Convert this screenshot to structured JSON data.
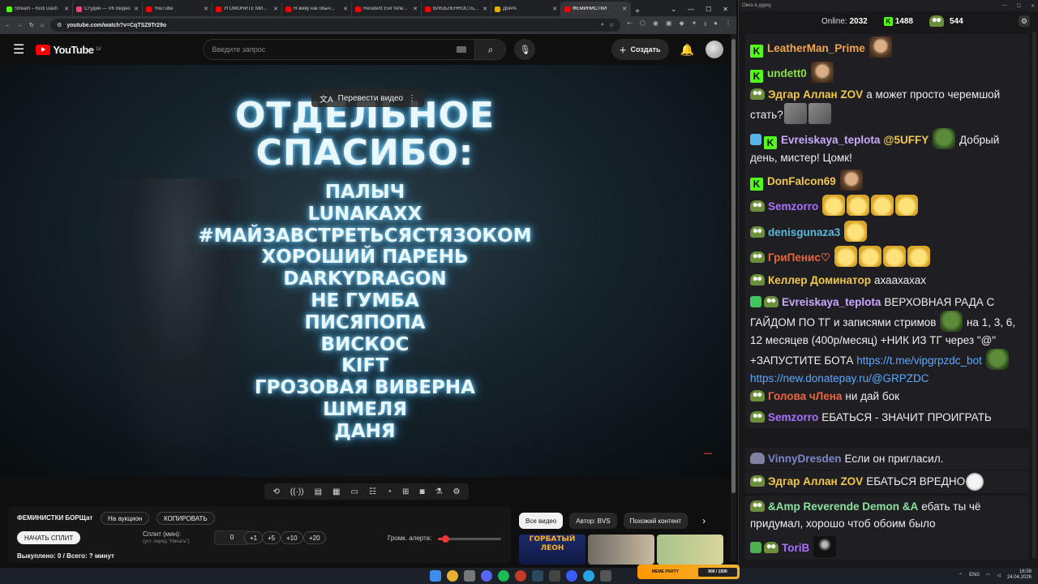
{
  "browser": {
    "tabs": [
      {
        "label": "Stream – Kick Dash",
        "color": "#53fc18",
        "active": false
      },
      {
        "label": "Студия — VK Видео",
        "color": "#e04870",
        "active": false
      },
      {
        "label": "YouTube",
        "color": "#ff0000",
        "active": false
      },
      {
        "label": "УГОМОНИТЕ МИ...",
        "color": "#ff0000",
        "active": false
      },
      {
        "label": "Я живу как обыч...",
        "color": "#ff0000",
        "active": false
      },
      {
        "label": "Resident Evil тепе...",
        "color": "#ff0000",
        "active": false
      },
      {
        "label": "ВЛЮБЛЕННОСТЬ...",
        "color": "#ff0000",
        "active": false
      },
      {
        "label": "ДЫРА",
        "color": "#e0b000",
        "active": false
      },
      {
        "label": "ФЕМИНИСТКИ",
        "color": "#ff0000",
        "active": true
      }
    ],
    "new_tab": "+",
    "url": "youtube.com/watch?v=CqTSZ9Tr29o"
  },
  "youtube": {
    "logo_text": "YouTube",
    "logo_region": "LV",
    "search_placeholder": "Введите запрос",
    "create_label": "Создать",
    "translate_label": "Перевести видео"
  },
  "video": {
    "heading_lines": [
      "ОТДЕЛЬНОЕ",
      "СПАСИБО:"
    ],
    "names": [
      "ПАЛЫЧ",
      "LUNAKAXX",
      "#МАЙЗАВСТРЕТЬСЯСТЯЗОКОМ",
      "ХОРОШИЙ ПАРЕНЬ",
      "DARKYDRAGON",
      "НЕ ГУМБА",
      "ПИСЯПОПА",
      "ВИСКОС",
      "KIFT",
      "ГРОЗОВАЯ ВИВЕРНА",
      "ШМЕЛЯ",
      "ДАНЯ"
    ]
  },
  "panel": {
    "title": "ФЕМИНИСТКИ БОРЩат",
    "auction_btn": "На аукцион",
    "copy_btn": "КОПИРОВАТЬ",
    "start_btn": "НАЧАТЬ СПЛИТ",
    "split_label": "Сплит (мин):",
    "split_hint": "(уст. перед \"Начать\")",
    "split_value": "0",
    "increments": [
      "+1",
      "+5",
      "+10",
      "+20"
    ],
    "alert_label": "Громк. алерта:",
    "alert_volume": 0.12,
    "status": "Выкуплено: 0 / Всего: ? минут"
  },
  "chips": [
    "Все видео",
    "Автор: BVS",
    "Похожий контент"
  ],
  "thumbnail_text": "ГОРБАТЫЙ ЛЕОН",
  "chat": {
    "window_title": "Окно в дурку",
    "online_label": "Online:",
    "online_count": "2032",
    "kick_count": "1488",
    "pepe_count": "544",
    "messages": [
      {
        "user": "LeatherMan_Prime",
        "color": "#f2a54a",
        "text": ""
      },
      {
        "user": "undett0",
        "color": "#8be050",
        "text": ""
      },
      {
        "user": "Эдгар Аллан ZOV",
        "color": "#f2c84a",
        "text": "а может просто черемшой стать?"
      },
      {
        "user": "Evreiskaya_teplota",
        "color": "#c9a8ff",
        "mention": "@5UFFY",
        "text": "Добрый день, мистер! Цомк!"
      },
      {
        "user": "DonFalcon69",
        "color": "#f2c84a",
        "text": ""
      },
      {
        "user": "Semzorro",
        "color": "#a970ff",
        "text": ""
      },
      {
        "user": "denisgunaza3",
        "color": "#5bb6d9",
        "text": ""
      },
      {
        "user": "ГриПенис♡",
        "color": "#e8673c",
        "text": ""
      },
      {
        "user": "Келлер Доминатор",
        "color": "#f2c84a",
        "text": "ахаахахах"
      },
      {
        "user": "Evreiskaya_teplota",
        "color": "#c9a8ff",
        "text": "ВЕРХОВНАЯ РАДА С ГАЙДОМ ПО ТГ и записями стримов",
        "text2": "на 1, 3, 6, 12 месяцев (400р/месяц) +НИК ИЗ ТГ через \"@\" +ЗАПУСТИТЕ БОТА",
        "link1": "https://t.me/vipgrpzdc_bot",
        "link2": "https://new.donatepay.ru/@GRPZDC"
      },
      {
        "user": "Голова чЛена",
        "color": "#e8673c",
        "text": "ни дай бок"
      },
      {
        "user": "Semzorro",
        "color": "#a970ff",
        "text": "ЕБАТЬСЯ - ЗНАЧИТ ПРОИГРАТЬ"
      },
      {
        "user": "VinnyDresden",
        "color": "#7a86c9",
        "text": "Если он пригласил."
      },
      {
        "user": "Эдгар Аллан ZOV",
        "color": "#f2c84a",
        "text": "ЕБАТЬСЯ ВРЕДНО"
      },
      {
        "user": "&Amp Reverende Demon &A",
        "color": "#8be0a0",
        "text": "ебать ты чё придумал, хорошо чтоб обоим было"
      },
      {
        "user": "ToriB",
        "color": "#a970ff",
        "text": ""
      }
    ]
  },
  "taskbar": {
    "meme_label": "MEME PARTY",
    "meme_progress": "900 / 1500",
    "lang": "ENG",
    "time": "16:58",
    "date": "24.04.2026"
  }
}
